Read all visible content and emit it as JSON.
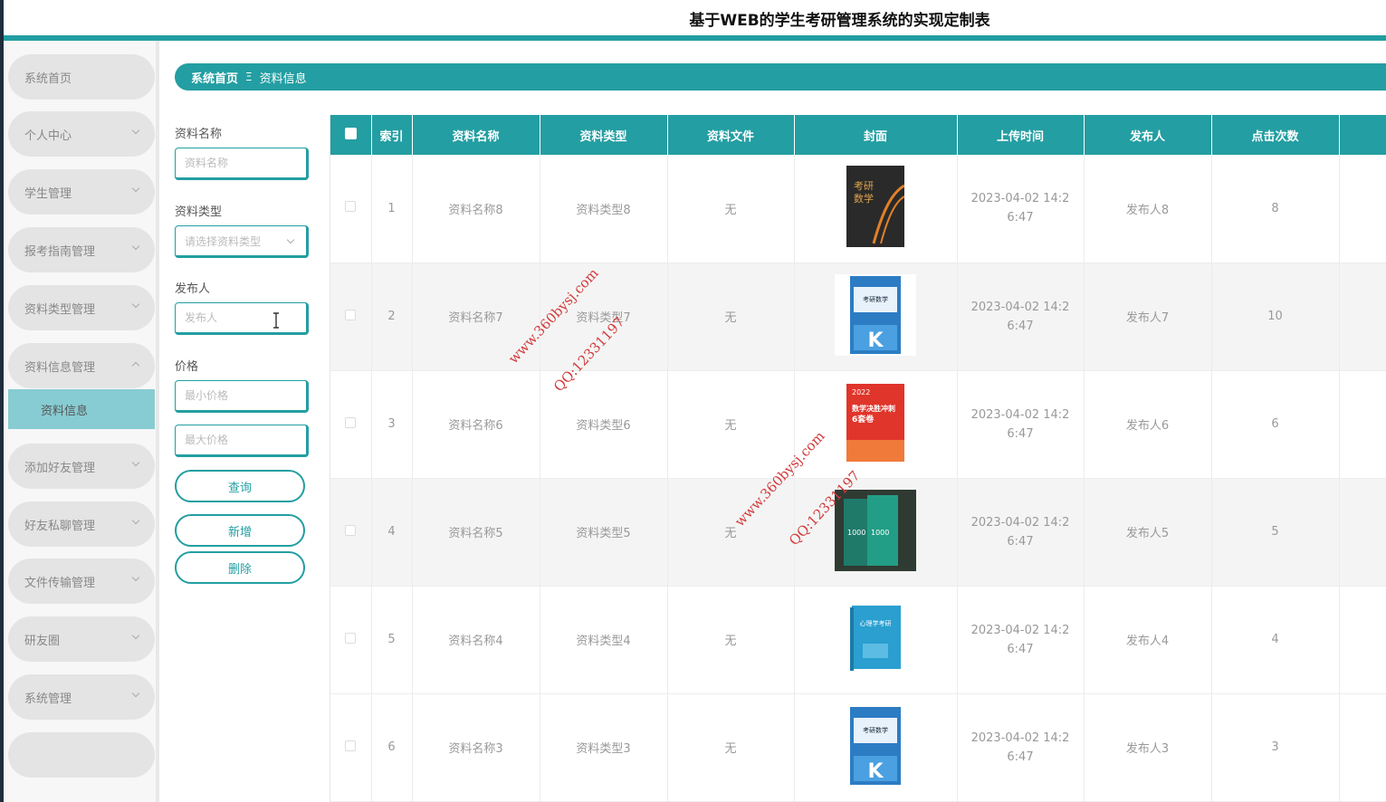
{
  "header": {
    "title": "基于WEB的学生考研管理系统的实现定制表"
  },
  "sidebar": {
    "items": [
      {
        "label": "系统首页",
        "expandable": false
      },
      {
        "label": "个人中心",
        "expandable": true
      },
      {
        "label": "学生管理",
        "expandable": true
      },
      {
        "label": "报考指南管理",
        "expandable": true
      },
      {
        "label": "资料类型管理",
        "expandable": true
      },
      {
        "label": "资料信息管理",
        "expandable": true,
        "expanded": true
      },
      {
        "label": "添加好友管理",
        "expandable": true
      },
      {
        "label": "好友私聊管理",
        "expandable": true
      },
      {
        "label": "文件传输管理",
        "expandable": true
      },
      {
        "label": "研友圈",
        "expandable": true
      },
      {
        "label": "系统管理",
        "expandable": true
      }
    ],
    "active_sub": "资料信息"
  },
  "breadcrumb": {
    "home": "系统首页",
    "separator": "Ξ",
    "current": "资料信息"
  },
  "filters": {
    "name_label": "资料名称",
    "name_placeholder": "资料名称",
    "type_label": "资料类型",
    "type_placeholder": "请选择资料类型",
    "publisher_label": "发布人",
    "publisher_placeholder": "发布人",
    "price_label": "价格",
    "min_price_placeholder": "最小价格",
    "max_price_placeholder": "最大价格",
    "query_button": "查询",
    "add_button": "新增",
    "delete_button": "删除"
  },
  "table": {
    "columns": [
      "索引",
      "资料名称",
      "资料类型",
      "资料文件",
      "封面",
      "上传时间",
      "发布人",
      "点击次数"
    ],
    "rows": [
      {
        "index": "1",
        "name": "资料名称8",
        "type": "资料类型8",
        "file": "无",
        "time": "2023-04-02 14:26:47",
        "publisher": "发布人8",
        "clicks": "8"
      },
      {
        "index": "2",
        "name": "资料名称7",
        "type": "资料类型7",
        "file": "无",
        "time": "2023-04-02 14:26:47",
        "publisher": "发布人7",
        "clicks": "10"
      },
      {
        "index": "3",
        "name": "资料名称6",
        "type": "资料类型6",
        "file": "无",
        "time": "2023-04-02 14:26:47",
        "publisher": "发布人6",
        "clicks": "6"
      },
      {
        "index": "4",
        "name": "资料名称5",
        "type": "资料类型5",
        "file": "无",
        "time": "2023-04-02 14:26:47",
        "publisher": "发布人5",
        "clicks": "5"
      },
      {
        "index": "5",
        "name": "资料名称4",
        "type": "资料类型4",
        "file": "无",
        "time": "2023-04-02 14:26:47",
        "publisher": "发布人4",
        "clicks": "4"
      },
      {
        "index": "6",
        "name": "资料名称3",
        "type": "资料类型3",
        "file": "无",
        "time": "2023-04-02 14:26:47",
        "publisher": "发布人3",
        "clicks": "3"
      }
    ]
  },
  "covers": [
    {
      "line1": "考研",
      "line2": "数学"
    },
    {
      "line1": "考研数学",
      "line2": "K"
    },
    {
      "line1": "2022",
      "line2": "数学决胜冲刺",
      "line3": "6套卷"
    },
    {
      "line1": "1000",
      "line2": "1000"
    },
    {
      "line1": "心理学考研"
    },
    {
      "line1": "考研数学",
      "line2": "K"
    }
  ],
  "watermarks": {
    "site": "www.360bysj.com",
    "qq": "QQ:12331197"
  },
  "colors": {
    "primary": "#239ea2",
    "submenu": "#87ccd2"
  }
}
